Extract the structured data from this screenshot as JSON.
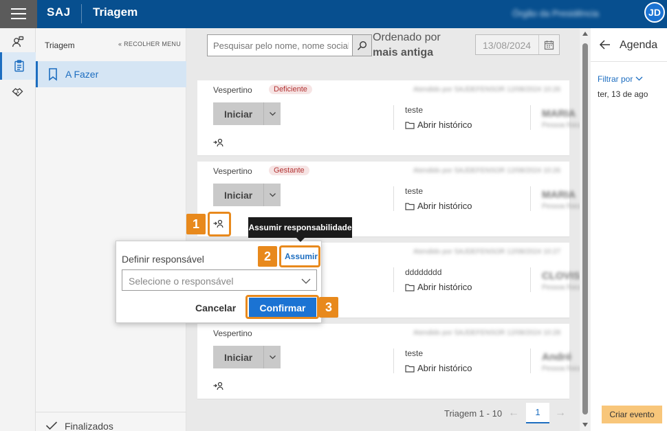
{
  "header": {
    "brand": "SAJ",
    "title": "Triagem",
    "user_initials": "JD",
    "user_name": "Órgão da Presidência"
  },
  "nav": {
    "title": "Triagem",
    "collapse_label": "RECOLHER MENU",
    "active_item": "A Fazer",
    "bottom_item": "Finalizados"
  },
  "toolbar": {
    "search_placeholder": "Pesquisar pelo nome, nome social",
    "order_label": "Ordenado por",
    "order_value": "mais antiga",
    "date_value": "13/08/2024"
  },
  "cards": [
    {
      "period": "Vespertino",
      "tag": "Deficiente",
      "meta": "Atendido por SAJDEFENSOR 12/08/2024 10:26",
      "start_label": "Iniciar",
      "note": "teste",
      "history_label": "Abrir histórico",
      "person": "MARIA",
      "person_sub": "Pessoa física"
    },
    {
      "period": "Vespertino",
      "tag": "Gestante",
      "meta": "Atendido por SAJDEFENSOR 12/08/2024 10:26",
      "start_label": "Iniciar",
      "note": "teste",
      "history_label": "Abrir histórico",
      "person": "MARIA",
      "person_sub": "Pessoa física"
    },
    {
      "period": "",
      "tag": "",
      "meta": "Atendido por SAJDEFENSOR 12/08/2024 10:27",
      "start_label": "Iniciar",
      "note": "dddddddd",
      "history_label": "Abrir histórico",
      "person": "CLOVIS",
      "person_sub": "Pessoa física"
    },
    {
      "period": "Vespertino",
      "tag": "",
      "meta": "Atendido por SAJDEFENSOR 12/08/2024 10:28",
      "start_label": "Iniciar",
      "note": "teste",
      "history_label": "Abrir histórico",
      "person": "André",
      "person_sub": "Pessoa física"
    }
  ],
  "pager": {
    "label": "Triagem 1 - 10",
    "current": "1"
  },
  "agenda": {
    "title": "Agenda",
    "filter_label": "Filtrar por",
    "date": "ter, 13 de ago",
    "create_label": "Criar evento"
  },
  "popover": {
    "tooltip": "Assumir responsabilidade",
    "assume_link": "Assumir",
    "field_label": "Definir responsável",
    "select_placeholder": "Selecione o responsável",
    "cancel_label": "Cancelar",
    "confirm_label": "Confirmar"
  },
  "steps": [
    "1",
    "2",
    "3"
  ],
  "colors": {
    "header": "#074f8f",
    "accent": "#1b73d3",
    "highlight": "#e8891c",
    "tag_bg": "#f6e4e4",
    "tag_text": "#b23232",
    "create_button": "#f8c67a"
  }
}
